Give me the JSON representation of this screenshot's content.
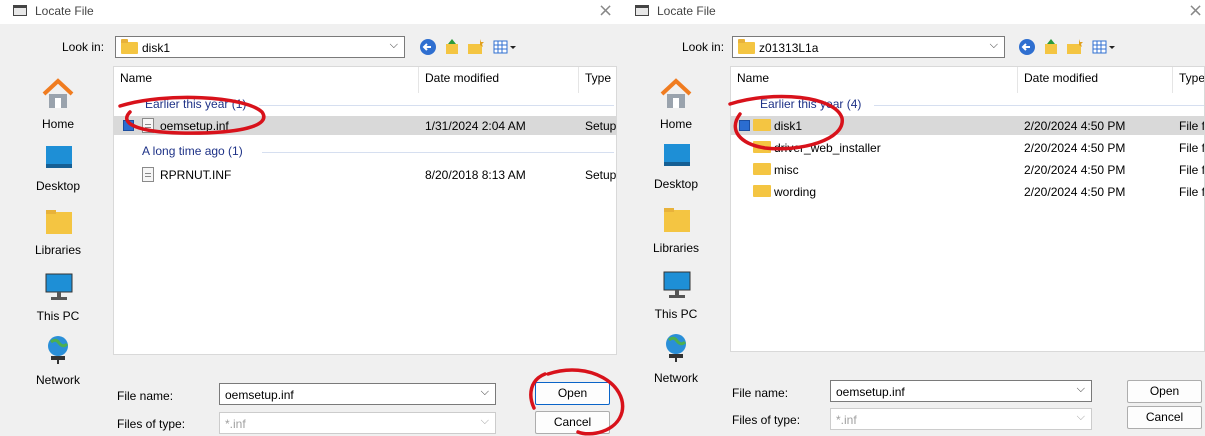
{
  "colors": {
    "annotation": "#d8121b",
    "accent": "#2b6dd1",
    "group_text": "#1e3287",
    "folder": "#f4c542"
  },
  "dialog1": {
    "title": "Locate File",
    "close_glyph": "×",
    "look_in_label": "Look in:",
    "look_in_value": "disk1",
    "columns": [
      "Name",
      "Date modified",
      "Type"
    ],
    "groups": [
      {
        "label": "Earlier this year (1)",
        "items": [
          {
            "name": "oemsetup.inf",
            "date": "1/31/2024 2:04 AM",
            "type": "Setup",
            "icon": "inf-file-icon",
            "selected": true
          }
        ]
      },
      {
        "label": "A long time ago (1)",
        "items": [
          {
            "name": "RPRNUT.INF",
            "date": "8/20/2018 8:13 AM",
            "type": "Setup",
            "icon": "inf-file-icon",
            "selected": false
          }
        ]
      }
    ],
    "places": [
      "Home",
      "Desktop",
      "Libraries",
      "This PC",
      "Network"
    ],
    "file_name_label": "File name:",
    "file_name_value": "oemsetup.inf",
    "files_of_type_label": "Files of type:",
    "files_of_type_value": "*.inf",
    "open_label": "Open",
    "cancel_label": "Cancel"
  },
  "dialog2": {
    "title": "Locate File",
    "close_glyph": "×",
    "look_in_label": "Look in:",
    "look_in_value": "z01313L1a",
    "columns": [
      "Name",
      "Date modified",
      "Type"
    ],
    "groups": [
      {
        "label": "Earlier this year (4)",
        "items": [
          {
            "name": "disk1",
            "date": "2/20/2024 4:50 PM",
            "type": "File fo",
            "icon": "folder-icon",
            "selected": true
          },
          {
            "name": "driver_web_installer",
            "date": "2/20/2024 4:50 PM",
            "type": "File fo",
            "icon": "folder-icon",
            "selected": false
          },
          {
            "name": "misc",
            "date": "2/20/2024 4:50 PM",
            "type": "File fo",
            "icon": "folder-icon",
            "selected": false
          },
          {
            "name": "wording",
            "date": "2/20/2024 4:50 PM",
            "type": "File fo",
            "icon": "folder-icon",
            "selected": false
          }
        ]
      }
    ],
    "places": [
      "Home",
      "Desktop",
      "Libraries",
      "This PC",
      "Network"
    ],
    "file_name_label": "File name:",
    "file_name_value": "oemsetup.inf",
    "files_of_type_label": "Files of type:",
    "files_of_type_value": "*.inf",
    "open_label": "Open",
    "cancel_label": "Cancel"
  }
}
